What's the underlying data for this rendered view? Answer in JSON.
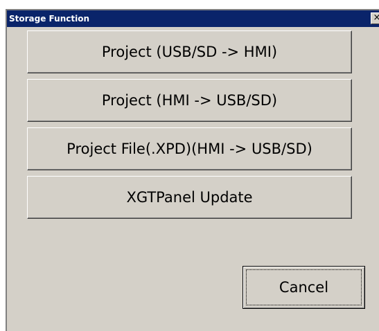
{
  "dialog": {
    "title": "Storage Function",
    "close_label": "×"
  },
  "buttons": [
    {
      "label": "Project (USB/SD -> HMI)"
    },
    {
      "label": "Project (HMI -> USB/SD)"
    },
    {
      "label": "Project File(.XPD)(HMI -> USB/SD)"
    },
    {
      "label": "XGTPanel Update"
    }
  ],
  "cancel": {
    "label": "Cancel"
  },
  "colors": {
    "titlebar": "#0a246a",
    "dialog_bg": "#d4d0c8"
  }
}
